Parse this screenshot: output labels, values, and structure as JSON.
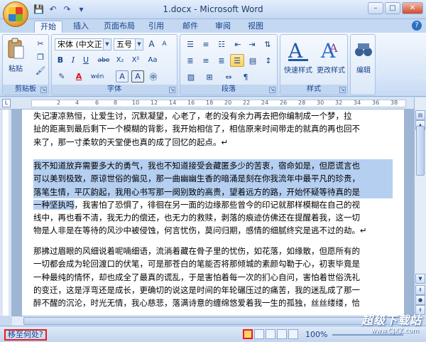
{
  "window": {
    "title": "1.docx - Microsoft Word",
    "min": "–",
    "max": "□",
    "close": "✕"
  },
  "qat": {
    "save": "💾",
    "undo": "↶",
    "redo": "↷",
    "more": "▾"
  },
  "tabs": [
    "开始",
    "插入",
    "页面布局",
    "引用",
    "邮件",
    "审阅",
    "视图"
  ],
  "ribbon": {
    "clipboard": {
      "label": "剪贴板",
      "paste": "粘贴"
    },
    "font": {
      "label": "字体",
      "font_name": "宋体 (中文正)",
      "font_size": "五号",
      "bold": "B",
      "italic": "I",
      "underline": "U",
      "strike": "abe",
      "sub": "X₂",
      "sup": "X²",
      "clear": "Aa",
      "grow": "A",
      "shrink": "A",
      "color_a": "A",
      "wen": "wén",
      "char_border": "A",
      "char_shade": "A"
    },
    "paragraph": {
      "label": "段落"
    },
    "styles": {
      "label": "样式",
      "quick": "快速样式",
      "change": "更改样式"
    },
    "editing": {
      "label": "编辑"
    }
  },
  "document": {
    "p0_lines": [
      "失记凄凉熟恒，让爱生讨，沉默凝望，心老了，老的没有余力再去把你编制成一个梦，拉",
      "扯的距离到最后剩下一个模糊的背影，我开始相信了，相信原来时间带走的就真的再也回不",
      "来了，那一寸柔软的天堂便也真的成了回忆的起点。↵"
    ],
    "p1_lines": [
      "我不知道放弃需要多大的勇气，我也不知道接受会藏匿多少的苦衷，宿命如是，但愿谎言也",
      "可以美到极致，原谅世俗的偏见，那一曲幽幽生香的暗涌是刻在你我流年中最平凡的珍贵，",
      "落笔生情，平仄韵起，我用心书写那一阕别致的高贵，望着远方的路，开始怀疑等待真的是",
      "一种坚执吗，我害怕了恐惧了，徘徊在另一面的边缘那些曾今的印记就那样模糊在自己的视",
      "线中，再也看不清，我无力的偿还，也无力的救赎，剥落的痕迹仿佛还在提醒着我，这一切",
      "物是人非是在等待的风沙中被侵蚀，何言忧伤，莫问归期，感情的细腻终究是逃不过的劫。↵"
    ],
    "p2_lines": [
      "那拂过眉眼的风细说着呢喃细语，流淌着藏在骨子里的忧伤，如花落，如缘散，但愿所有的",
      "一切都会成为轮回渡口的伏笔，可是那苍白的笔能否将那倾城的素颜勾勒于心，初衷毕竟是",
      "一种最纯的情怀，却也成全了最真的谎乱，于是害怕着每一次的扪心自问，害怕着世俗洗礼",
      "的变迁，这是浮弯还是成长，更确切的说这是时间的年轮碾压过的痛苦，我的迷乱成了那一",
      "醉不醒的沉沦，时光无情，我心慈悲，落满诗意的缠绵悠爱着我一生的孤独，丝丝缕缕，恰"
    ]
  },
  "status": {
    "text": "移至何处?",
    "zoom": "100%"
  },
  "watermark": {
    "text": "超级下载站",
    "url": "www.CJXZ.com"
  },
  "accent": "#15428b",
  "selection_color": "#b5cff1"
}
